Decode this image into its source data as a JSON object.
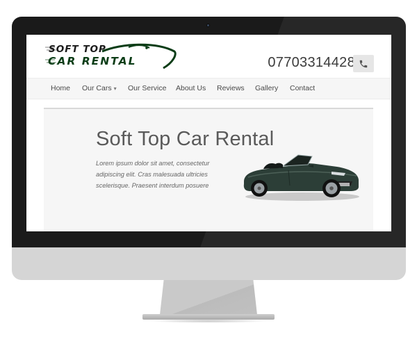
{
  "site": {
    "logo": {
      "line1": "SOFT TOP",
      "line2": "CAR RENTAL"
    },
    "phone": "07703314428",
    "phone_icon": "phone-icon"
  },
  "nav": {
    "items": [
      {
        "label": "Home"
      },
      {
        "label": "Our Cars",
        "has_dropdown": true
      },
      {
        "label": "Our Service"
      },
      {
        "label": "About Us"
      },
      {
        "label": "Reviews"
      },
      {
        "label": "Gallery"
      },
      {
        "label": "Contact"
      }
    ],
    "dropdown_caret": "▾"
  },
  "hero": {
    "title": "Soft Top Car Rental",
    "text": "Lorem ipsum dolor sit amet, consectetur adipiscing elit. Cras malesuada ultricies scelerisque. Praesent interdum posuere",
    "image": "convertible-car"
  },
  "colors": {
    "brand_dark_green": "#0b3d17",
    "bezel": "#1a1a1a",
    "stand": "#d5d5d5",
    "car_body": "#2c3e37"
  }
}
